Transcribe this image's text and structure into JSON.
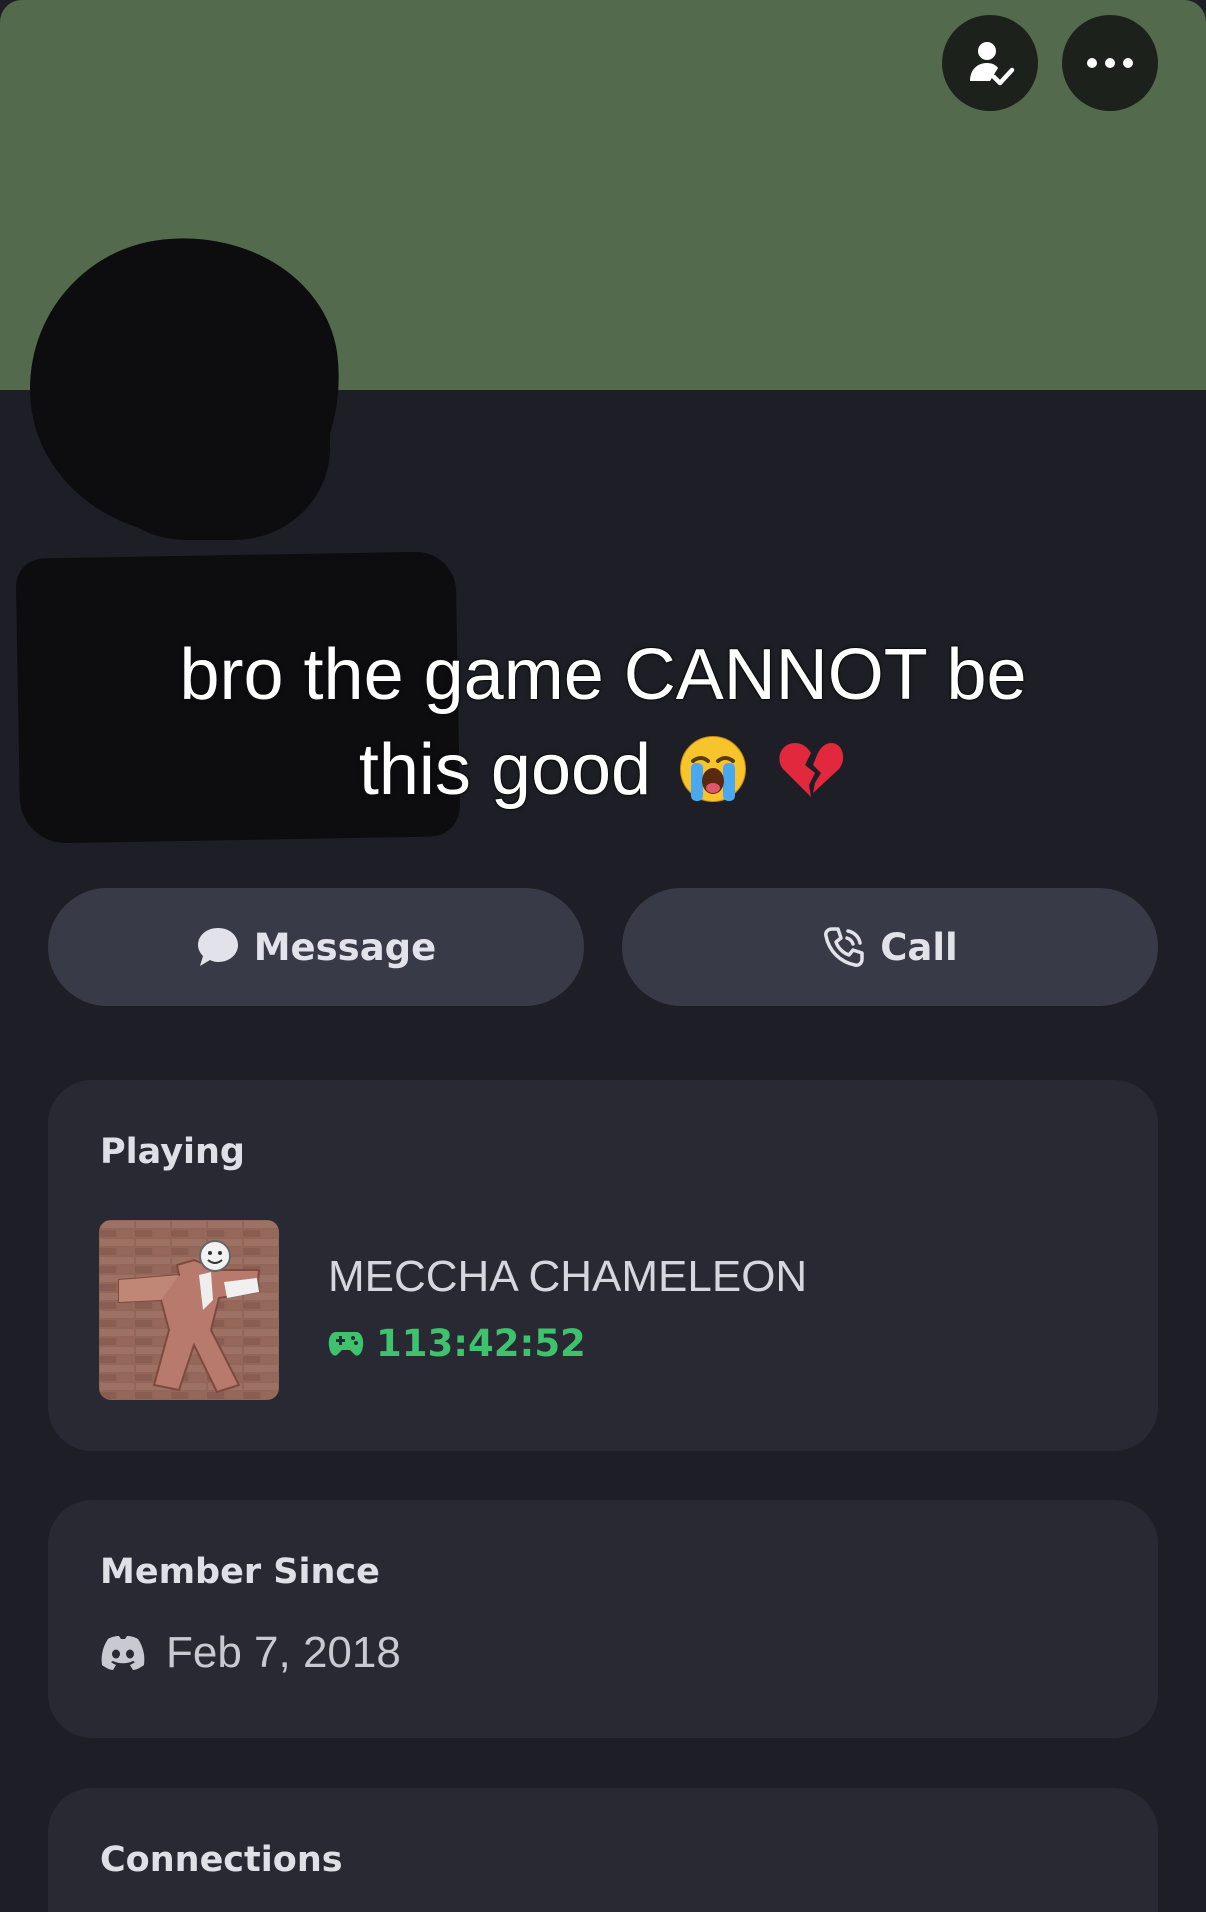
{
  "header": {
    "friend_icon": "person-check-icon",
    "more_icon": "ellipsis-icon"
  },
  "caption": {
    "line1": "bro the game CANNOT be",
    "line2": "this good",
    "emojis": [
      "loudly-crying-face",
      "broken-heart"
    ]
  },
  "actions": {
    "message_label": "Message",
    "call_label": "Call"
  },
  "playing": {
    "title": "Playing",
    "game_name": "MECCHA CHAMELEON",
    "elapsed": "113:42:52",
    "elapsed_icon": "gamepad-icon"
  },
  "member_since": {
    "title": "Member Since",
    "date": "Feb 7, 2018",
    "icon": "discord-logo-icon"
  },
  "connections": {
    "title": "Connections"
  },
  "colors": {
    "banner": "#536a4c",
    "background": "#1e1f26",
    "card": "#282933",
    "button": "#393a47",
    "accent_green": "#3ec26e"
  }
}
